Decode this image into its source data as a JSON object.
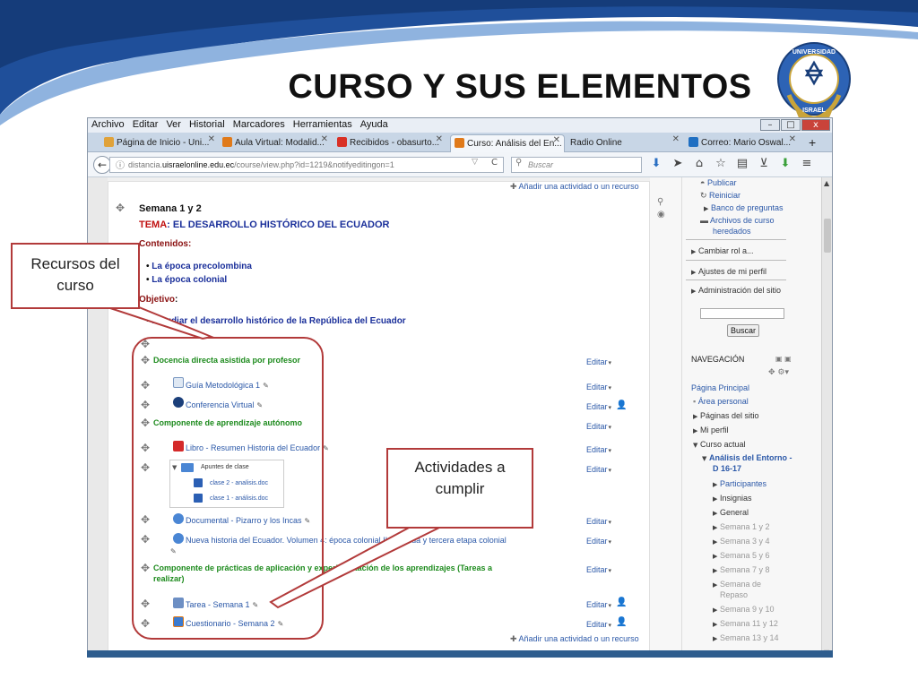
{
  "slide": {
    "title": "CURSO Y SUS ELEMENTOS",
    "seal_text_top": "UNIVERSIDAD",
    "seal_text_bottom": "ISRAEL"
  },
  "callouts": {
    "recursos": [
      "Recursos del",
      "curso"
    ],
    "actividades": [
      "Actividades a",
      "cumplir"
    ]
  },
  "browser": {
    "menu": [
      "Archivo",
      "Editar",
      "Ver",
      "Historial",
      "Marcadores",
      "Herramientas",
      "Ayuda"
    ],
    "window_buttons": [
      "–",
      "□",
      "x"
    ],
    "tabs": [
      {
        "label": "Página de Inicio - Uni...",
        "icon_color": "#e0a23a"
      },
      {
        "label": "Aula Virtual: Modalid...",
        "icon_color": "#e07a1a"
      },
      {
        "label": "Recibidos - obasurto...",
        "icon_color": "#d93025"
      },
      {
        "label": "Curso: Análisis del En...",
        "icon_color": "#e07a1a"
      },
      {
        "label": "Radio Online",
        "icon_color": ""
      },
      {
        "label": "Correo: Mario Oswal...",
        "icon_color": "#1f6fc2"
      }
    ],
    "url_prefix": "distancia.",
    "url_domain": "uisraelonline.edu.ec",
    "url_path": "/course/view.php?id=1219&notifyeditingon=1",
    "search_placeholder": "Buscar",
    "nav_icons": [
      "download-icon",
      "send-icon",
      "home-icon",
      "star-icon",
      "reader-icon",
      "pocket-icon",
      "addon-icon",
      "menu-icon"
    ]
  },
  "course": {
    "add_activity": "Añadir una actividad o un recurso",
    "section_title": "Semana 1 y 2",
    "tema_label": "TEMA",
    "tema_value": ": EL DESARROLLO HISTÓRICO DEL ECUADOR",
    "contenidos_label": "Contenidos:",
    "contenidos": [
      "La época precolombina",
      "La época colonial"
    ],
    "objetivo_label": "Objetivo",
    "objetivo_colon": ":",
    "objetivo_item": "Estudiar el desarrollo histórico de la República del Ecuador",
    "edit_label": "Editar",
    "docencia": "Docencia directa asistida por profesor",
    "guia": "Guía Metodológica 1",
    "conferencia": "Conferencia Virtual",
    "componente_autonomo": "Componente  de aprendizaje autónomo",
    "libro": "Libro - Resumen Historia del Ecuador",
    "apuntes": "Apuntes de clase",
    "clase2": "clase 2 - analisis.doc",
    "clase1": "clase 1 - análisis.doc",
    "documental": "Documental - Pizarro y los Incas",
    "nueva_historia": "Nueva historia del Ecuador. Volumen 4: época colonial II segunda y tercera etapa colonial",
    "componente_practicas_1": "Componente de prácticas de aplicación y experimentación de los aprendizajes (Tareas a",
    "componente_practicas_2": "realizar)",
    "tarea": "Tarea - Semana 1",
    "cuestionario": "Cuestionario - Semana 2"
  },
  "sidebar": {
    "admin_items": [
      "Publicar",
      "Reiniciar",
      "Banco de preguntas",
      "Archivos de curso",
      "heredados"
    ],
    "cambiar_rol": "Cambiar rol a...",
    "ajustes": "Ajustes de mi perfil",
    "administracion": "Administración del sitio",
    "buscar_button": "Buscar",
    "nav_title": "NAVEGACIÓN",
    "pagina_principal": "Página Principal",
    "area_personal": "Área personal",
    "paginas_sitio": "Páginas del sitio",
    "mi_perfil": "Mi perfil",
    "curso_actual": "Curso actual",
    "analisis": "Análisis del Entorno -",
    "analisis2": "D 16-17",
    "participantes": "Participantes",
    "insignias": "Insignias",
    "general": "General",
    "semanas": [
      "Semana 1 y 2",
      "Semana 3 y 4",
      "Semana 5 y 6",
      "Semana 7 y 8",
      "Semana de",
      "Repaso",
      "Semana 9 y 10",
      "Semana 11 y 12",
      "Semana 13 y 14"
    ]
  }
}
